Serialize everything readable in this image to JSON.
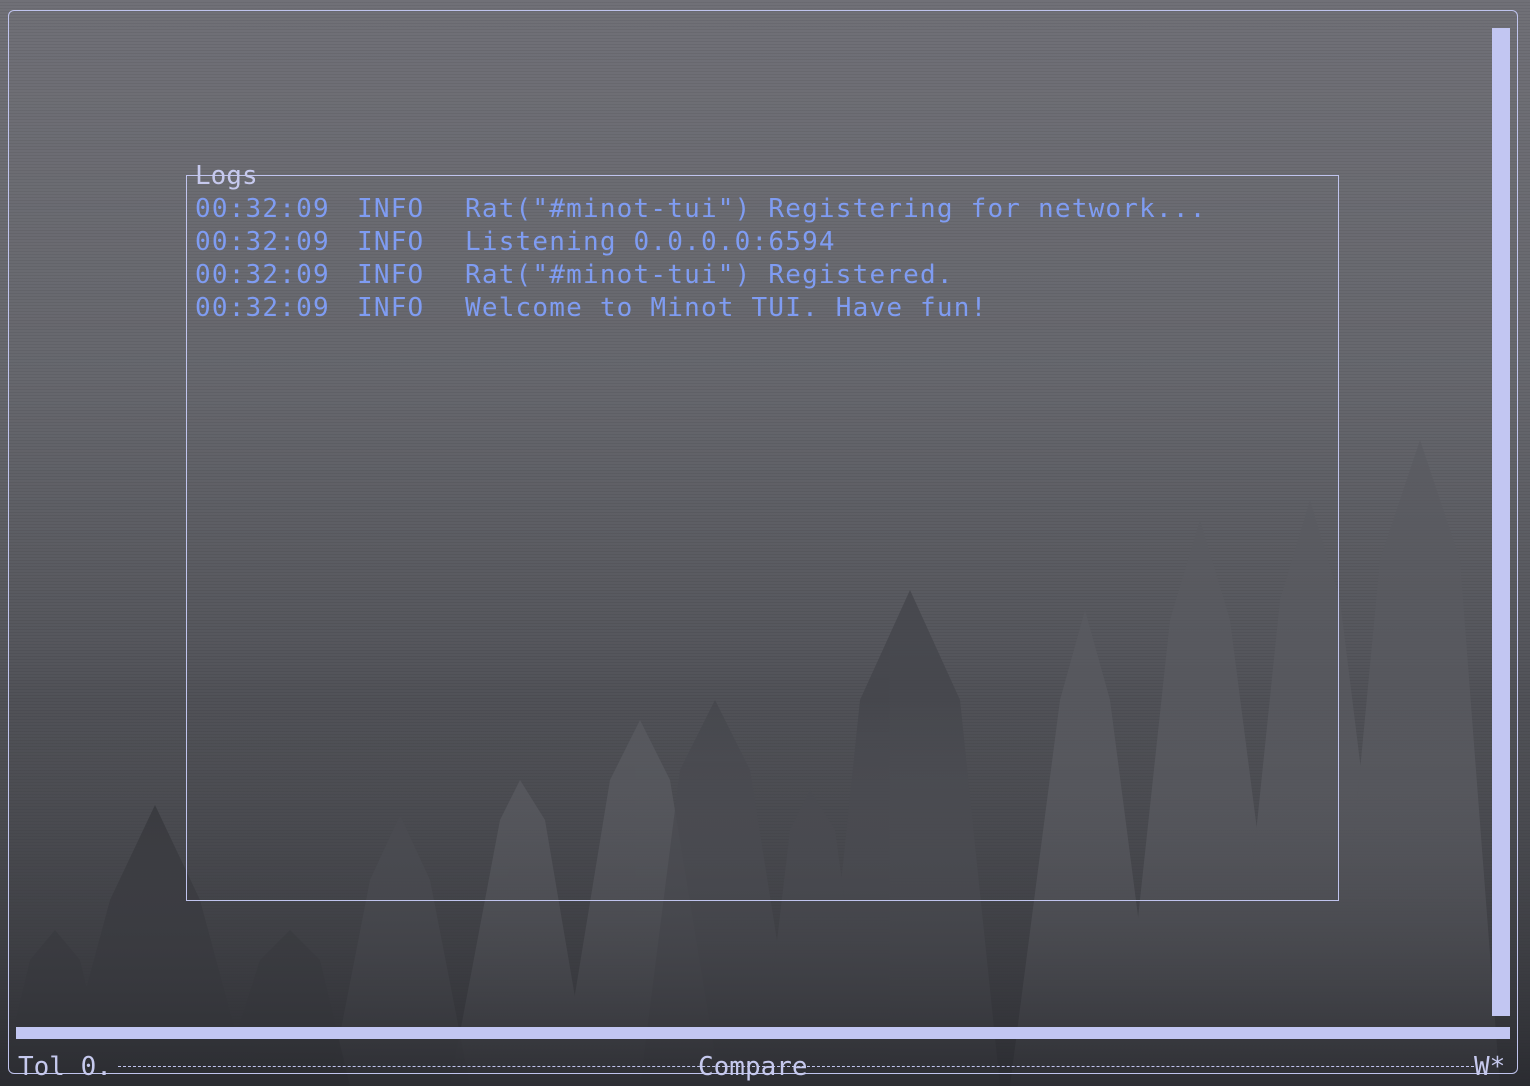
{
  "colors": {
    "frame": "#c0c4ee",
    "log_text": "#7f9cf2",
    "scrollbar": "#c2c6f2"
  },
  "logs_panel": {
    "title": "Logs",
    "lines": [
      {
        "time": "00:32:09",
        "level": "INFO",
        "message": "Rat(\"#minot-tui\") Registering for network..."
      },
      {
        "time": "00:32:09",
        "level": "INFO",
        "message": "Listening 0.0.0.0:6594"
      },
      {
        "time": "00:32:09",
        "level": "INFO",
        "message": "Rat(\"#minot-tui\") Registered."
      },
      {
        "time": "00:32:09",
        "level": "INFO",
        "message": "Welcome to Minot TUI. Have fun!"
      }
    ]
  },
  "status_bar": {
    "left": "Tol 0.",
    "center": "Compare",
    "right": "W*"
  }
}
